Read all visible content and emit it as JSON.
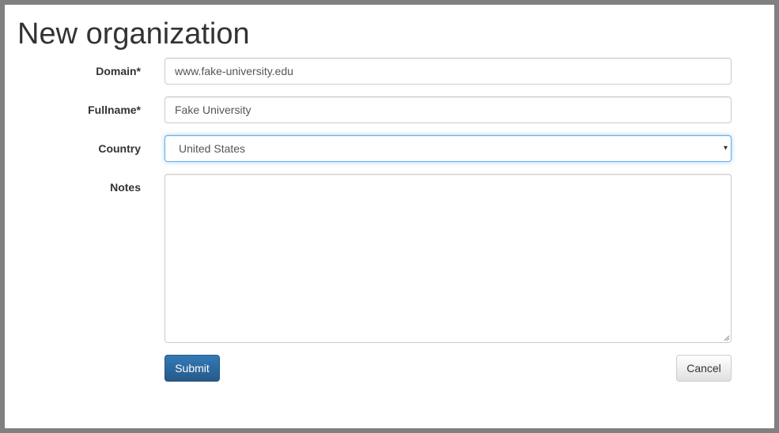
{
  "page": {
    "title": "New organization"
  },
  "form": {
    "domain": {
      "label": "Domain*",
      "value": "www.fake-university.edu"
    },
    "fullname": {
      "label": "Fullname*",
      "value": "Fake University"
    },
    "country": {
      "label": "Country",
      "selected": "United States"
    },
    "notes": {
      "label": "Notes",
      "value": ""
    },
    "submit_label": "Submit",
    "cancel_label": "Cancel"
  },
  "icons": {
    "select_caret": "▾"
  },
  "colors": {
    "primary": "#337ab7",
    "focus_border": "#66afe9",
    "backdrop": "#808080"
  }
}
